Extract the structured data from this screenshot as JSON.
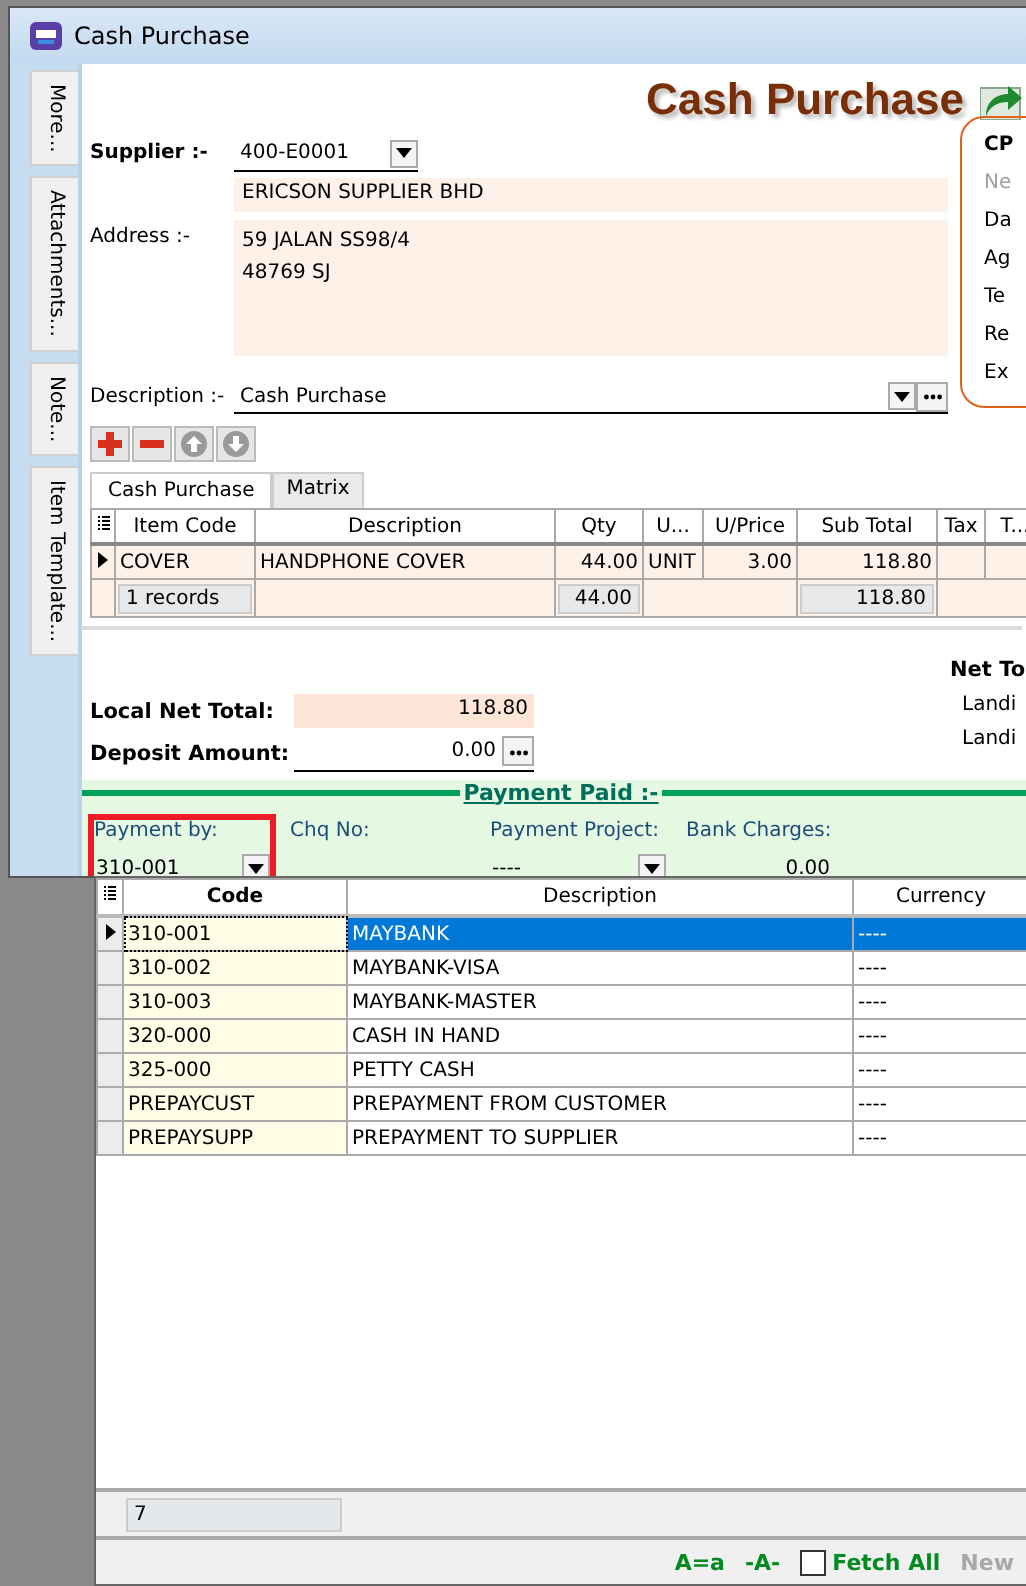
{
  "window": {
    "title": "Cash Purchase"
  },
  "side_tabs": [
    "More...",
    "Attachments...",
    "Note...",
    "Item Template..."
  ],
  "heading": "Cash Purchase",
  "supplier": {
    "label": "Supplier :-",
    "code": "400-E0001",
    "name": "ERICSON SUPPLIER BHD"
  },
  "address": {
    "label": "Address :-",
    "lines": [
      "59 JALAN SS98/4",
      "48769 SJ"
    ]
  },
  "description": {
    "label": "Description :-",
    "value": "Cash Purchase"
  },
  "side_panel": [
    {
      "text": "CP",
      "kind": "title",
      "disabled": false
    },
    {
      "text": "Ne",
      "kind": "field",
      "disabled": true
    },
    {
      "text": "Da",
      "kind": "field",
      "disabled": false
    },
    {
      "text": "Ag",
      "kind": "field",
      "disabled": false
    },
    {
      "text": "Te",
      "kind": "field",
      "disabled": false
    },
    {
      "text": "Re",
      "kind": "field",
      "disabled": false
    },
    {
      "text": "Ex",
      "kind": "field",
      "disabled": false
    }
  ],
  "tabs": [
    {
      "label": "Cash Purchase",
      "selected": true
    },
    {
      "label": "Matrix",
      "selected": false
    }
  ],
  "items_table": {
    "columns": [
      "Item Code",
      "Description",
      "Qty",
      "U...",
      "U/Price",
      "Sub Total",
      "Tax",
      "T..."
    ],
    "rows": [
      {
        "current": true,
        "cells": [
          "COVER",
          "HANDPHONE COVER",
          "44.00",
          "UNIT",
          "3.00",
          "118.80",
          "",
          ""
        ]
      }
    ],
    "footer": {
      "records": "1 records",
      "qty": "44.00",
      "sub_total": "118.80"
    }
  },
  "totals": {
    "local_net_total": {
      "label": "Local Net Total:",
      "value": "118.80"
    },
    "deposit": {
      "label": "Deposit Amount:",
      "value": "0.00"
    },
    "net_total_label": "Net To",
    "landing_labels": [
      "Landi",
      "Landi"
    ]
  },
  "payment": {
    "title": "Payment Paid :-",
    "fields": [
      {
        "label": "Payment by:",
        "value": "310-001",
        "kind": "dropdown",
        "highlighted": true
      },
      {
        "label": "Chq No:",
        "kind": "text",
        "highlighted": false
      },
      {
        "label": "Payment Project:",
        "value": "----",
        "kind": "dropdown",
        "highlighted": false
      },
      {
        "label": "Bank Charges:",
        "value": "0.00",
        "kind": "number",
        "highlighted": false
      }
    ]
  },
  "lookup": {
    "columns": [
      "Code",
      "Description",
      "Currency"
    ],
    "rows": [
      {
        "code": "310-001",
        "description": "MAYBANK",
        "currency": "----",
        "selected": true
      },
      {
        "code": "310-002",
        "description": "MAYBANK-VISA",
        "currency": "----",
        "selected": false
      },
      {
        "code": "310-003",
        "description": "MAYBANK-MASTER",
        "currency": "----",
        "selected": false
      },
      {
        "code": "320-000",
        "description": "CASH IN HAND",
        "currency": "----",
        "selected": false
      },
      {
        "code": "325-000",
        "description": "PETTY CASH",
        "currency": "----",
        "selected": false
      },
      {
        "code": "PREPAYCUST",
        "description": "PREPAYMENT FROM CUSTOMER",
        "currency": "----",
        "selected": false
      },
      {
        "code": "PREPAYSUPP",
        "description": "PREPAYMENT TO SUPPLIER",
        "currency": "----",
        "selected": false
      }
    ],
    "count": "7",
    "case_option": "A=a",
    "partial_option": "-A-",
    "fetch_all": {
      "label": "Fetch All",
      "checked": false
    },
    "new_button": {
      "label": "New",
      "disabled": true
    }
  }
}
